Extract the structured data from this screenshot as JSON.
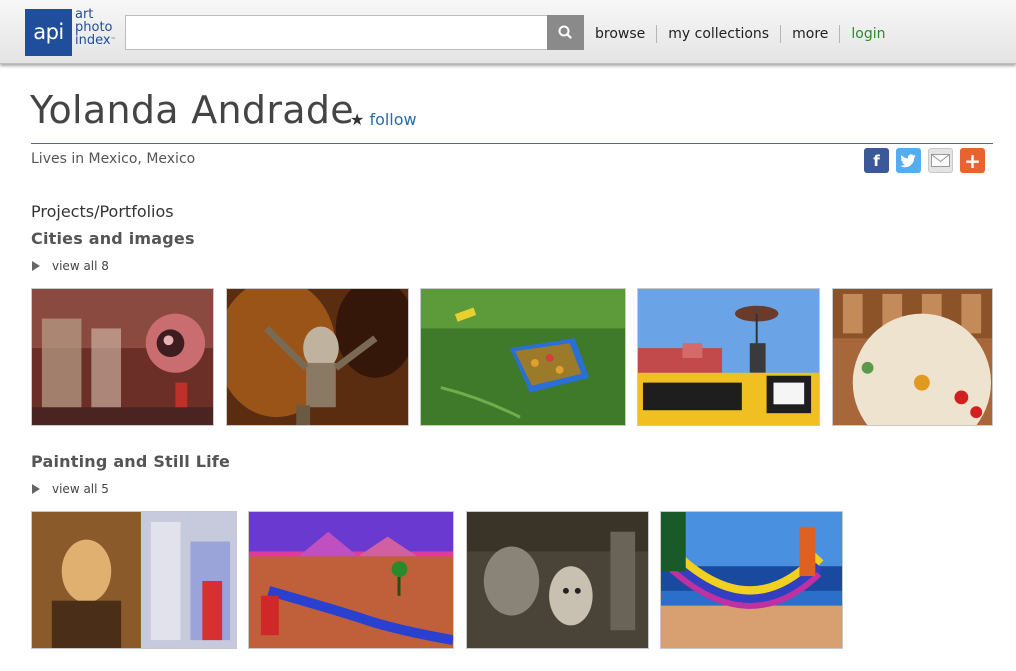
{
  "header": {
    "logo_abbr": "api",
    "logo_lines": [
      "art",
      "photo",
      "index"
    ],
    "logo_tm": "™",
    "search_value": "",
    "search_placeholder": "",
    "nav": [
      "browse",
      "my collections",
      "more",
      "login"
    ]
  },
  "profile": {
    "name": "Yolanda Andrade",
    "follow_star": "★",
    "follow_label": "follow",
    "location": "Lives in Mexico, Mexico",
    "share": [
      "f",
      "t",
      "✉",
      "+"
    ]
  },
  "sections": {
    "heading": "Projects/Portfolios",
    "projects": [
      {
        "title": "Cities and images",
        "view_all": "view all 8",
        "thumbs": [
          "eye-sculpture-jars",
          "fire-figure-sculpture",
          "floating-basket-water",
          "school-bus-parasol-statue",
          "carved-temple-parasol"
        ]
      },
      {
        "title": "Painting and Still Life",
        "view_all": "view all 5",
        "thumbs": [
          "mona-lisa-collage",
          "colorful-landscape-mural",
          "weathered-wall-faces",
          "hammock-beach-painting"
        ]
      }
    ]
  },
  "colors": {
    "brand_blue": "#1f4e9a",
    "link_blue": "#2a6ba8",
    "login_green": "#2c8a2c",
    "rule_blue": "#3a6fa8"
  }
}
